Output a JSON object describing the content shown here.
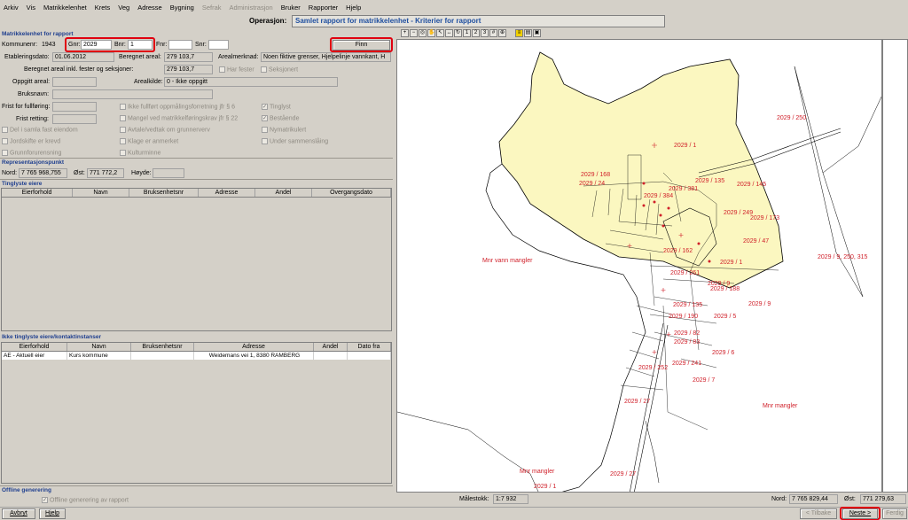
{
  "menu": [
    "Arkiv",
    "Vis",
    "Matrikkelenhet",
    "Krets",
    "Veg",
    "Adresse",
    "Bygning",
    "Sefrak",
    "Administrasjon",
    "Bruker",
    "Rapporter",
    "Hjelp"
  ],
  "menu_disabled": [
    "Sefrak",
    "Administrasjon"
  ],
  "operation": {
    "label": "Operasjon:",
    "value": "Samlet rapport for matrikkelenhet - Kriterier for rapport"
  },
  "matrikkel": {
    "title": "Matrikkelenhet for rapport",
    "kommunenr_label": "Kommunenr:",
    "kommunenr": "1943",
    "gnr_label": "Gnr:",
    "gnr": "2029",
    "bnr_label": "Bnr:",
    "bnr": "1",
    "fnr_label": "Fnr:",
    "fnr": "",
    "snr_label": "Snr:",
    "snr": "",
    "finn": "Finn",
    "etablering_label": "Etableringsdato:",
    "etablering": "01.06.2012",
    "beregnet_label": "Beregnet areal:",
    "beregnet": "279 103,7",
    "arealmerknad_label": "Arealmerknad:",
    "arealmerknad": "Noen fiktive grenser, Hjelpelinje vannkant, H",
    "beregnet_inkl_label": "Beregnet areal inkl. fester og seksjoner:",
    "beregnet_inkl": "279 103,7",
    "har_fester": "Har fester",
    "seksjonert": "Seksjonert",
    "oppgitt_label": "Oppgitt areal:",
    "oppgitt": "",
    "arealkilde_label": "Arealkilde:",
    "arealkilde": "0  - Ikke oppgitt",
    "bruksnavn_label": "Bruksnavn:",
    "bruksnavn": "",
    "frist_fullforing_label": "Frist for fullføring:",
    "frist_fullforing": "",
    "frist_retting_label": "Frist retting:",
    "frist_retting": "",
    "checks_mid": [
      "Ikke fullført oppmålingsforretning jfr § 6",
      "Mangel ved matrikkelføringskrav jfr § 22",
      "Avtale/vedtak om grunnerverv",
      "Klage er anmerket",
      "Kulturminne"
    ],
    "checks_left": [
      "Del i samla fast eiendom",
      "Jordskifte er krevd",
      "Grunnforurensning"
    ],
    "checks_right": [
      "Tinglyst",
      "Bestående",
      "Nymatrikulert",
      "Under sammenslåing"
    ]
  },
  "repr": {
    "title": "Representasjonspunkt",
    "nord_label": "Nord:",
    "nord": "7 765 968,755",
    "ost_label": "Øst:",
    "ost": "771 772,2",
    "hoyde_label": "Høyde:",
    "hoyde": ""
  },
  "tinglyste": {
    "title": "Tinglyste eiere",
    "columns": [
      "Eierforhold",
      "Navn",
      "Bruksenhetsnr",
      "Adresse",
      "Andel",
      "Overgangsdato"
    ]
  },
  "ikke_tinglyste": {
    "title": "Ikke tinglyste eiere/kontaktinstanser",
    "columns": [
      "Eierforhold",
      "Navn",
      "Bruksenhetsnr",
      "Adresse",
      "Andel",
      "Dato fra"
    ],
    "rows": [
      [
        "AE - Aktuell eier",
        "Kurs kommune",
        "",
        "Weidemans vei 1, 8380 RAMBERG",
        "",
        ""
      ]
    ]
  },
  "offline": {
    "title": "Offline generering",
    "check": "Offline generering av rapport"
  },
  "map_labels": [
    "2029 / 250",
    "2029 / 1",
    "2029 / 168",
    "2029 / 24",
    "2029 / 135",
    "2029 / 145",
    "2029 / 249",
    "2029 / 173",
    "2029 / 47",
    "2029 / 1",
    "2029 / 9, 250, 315",
    "Mnr vann mangler",
    "2029 / 9",
    "2029 / 188",
    "2029 / 135",
    "2029 / 190",
    "2029 / 5",
    "2029 / 9",
    "2029 / 6",
    "2029 / 7",
    "2029 / 27",
    "Mnr mangler",
    "Mnr mangler",
    "2029 / 27",
    "2029 / 1",
    "2029 / 82",
    "2029 / 83",
    "2029 / 241",
    "2029 / 252",
    "2029 / 381",
    "2029 / 384",
    "2029 / 162",
    "2029 / 261"
  ],
  "status": {
    "malestokk_label": "Målestokk:",
    "malestokk": "1:7 932",
    "nord_label": "Nord:",
    "nord": "7 765 829,44",
    "ost_label": "Øst:",
    "ost": "771 279,63"
  },
  "bottom": {
    "avbryt": "Avbryt",
    "hjelp": "Hjelp",
    "tilbake": "< Tilbake",
    "neste": "Neste >",
    "ferdig": "Ferdig"
  },
  "colors": {
    "highlight": "#e00010",
    "parcel_fill": "#fbf7c0",
    "map_text": "#d0202a",
    "title_blue": "#1f3f8f"
  }
}
